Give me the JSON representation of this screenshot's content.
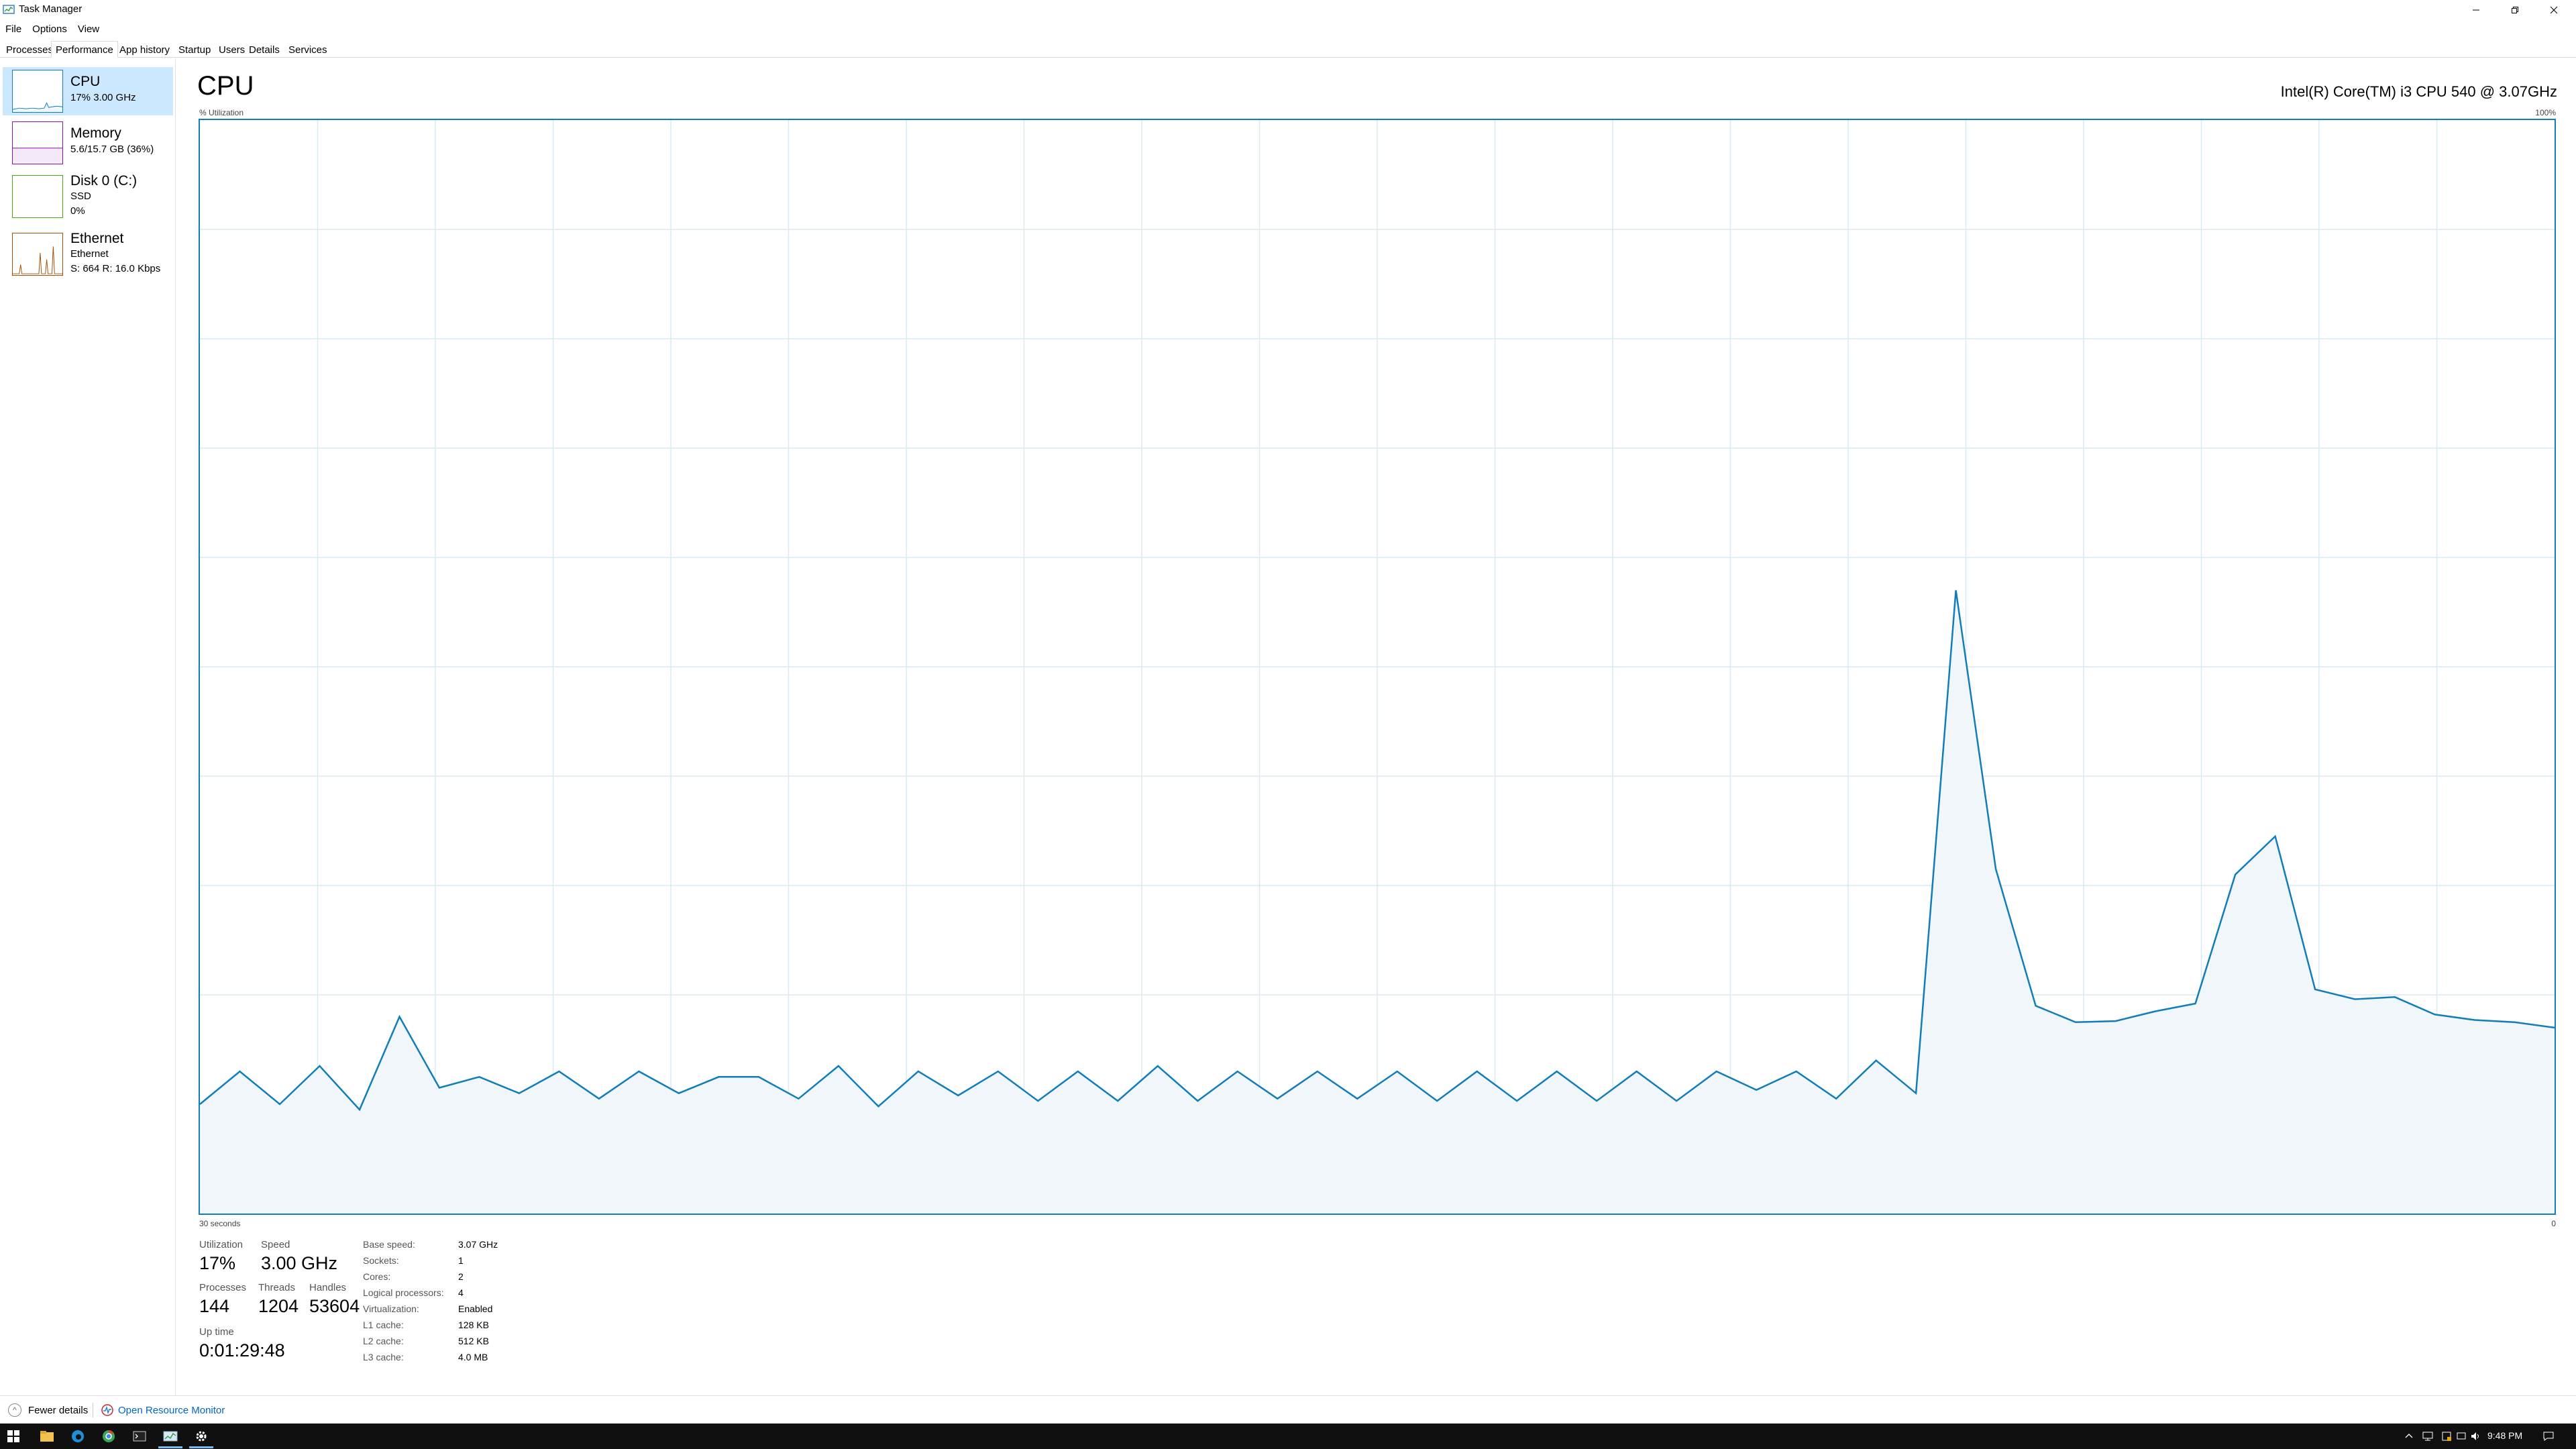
{
  "window": {
    "title": "Task Manager"
  },
  "menu": [
    "File",
    "Options",
    "View"
  ],
  "tabs": [
    "Processes",
    "Performance",
    "App history",
    "Startup",
    "Users",
    "Details",
    "Services"
  ],
  "active_tab": "Performance",
  "sidebar": {
    "items": [
      {
        "title": "CPU",
        "lines": [
          "17% 3.00 GHz"
        ],
        "color": "#117dbb"
      },
      {
        "title": "Memory",
        "lines": [
          "5.6/15.7 GB (36%)"
        ],
        "color": "#8b12ae"
      },
      {
        "title": "Disk 0 (C:)",
        "lines": [
          "SSD",
          "0%"
        ],
        "color": "#4da60c"
      },
      {
        "title": "Ethernet",
        "lines": [
          "Ethernet",
          "S: 664  R: 16.0 Kbps"
        ],
        "color": "#a74f01"
      }
    ]
  },
  "main": {
    "heading": "CPU",
    "cpu_model": "Intel(R) Core(TM) i3 CPU 540 @ 3.07GHz",
    "graph_label": "% Utilization",
    "graph_max": "100%",
    "time_span": "30 seconds",
    "graph_min": "0",
    "utilization_history": [
      10,
      13,
      10,
      13.5,
      9.5,
      18,
      11.5,
      12.5,
      11,
      13,
      10.5,
      13,
      11,
      12.5,
      12.5,
      10.5,
      13.5,
      9.8,
      13,
      10.8,
      13,
      10.3,
      13,
      10.3,
      13.5,
      10.3,
      13,
      10.5,
      13,
      10.5,
      13,
      10.3,
      13,
      10.3,
      13,
      10.3,
      13,
      10.3,
      13,
      11.3,
      13,
      10.5,
      14,
      11,
      57,
      31.5,
      19,
      17.5,
      17.6,
      18.5,
      19.2,
      31,
      34.5,
      20.5,
      19.6,
      19.8,
      18.2,
      17.7,
      17.5,
      17
    ]
  },
  "stats": {
    "utilization": {
      "label": "Utilization",
      "value": "17%"
    },
    "speed": {
      "label": "Speed",
      "value": "3.00 GHz"
    },
    "processes": {
      "label": "Processes",
      "value": "144"
    },
    "threads": {
      "label": "Threads",
      "value": "1204"
    },
    "handles": {
      "label": "Handles",
      "value": "53604"
    },
    "uptime": {
      "label": "Up time",
      "value": "0:01:29:48"
    }
  },
  "specs": [
    {
      "label": "Base speed:",
      "value": "3.07 GHz"
    },
    {
      "label": "Sockets:",
      "value": "1"
    },
    {
      "label": "Cores:",
      "value": "2"
    },
    {
      "label": "Logical processors:",
      "value": "4"
    },
    {
      "label": "Virtualization:",
      "value": "Enabled"
    },
    {
      "label": "L1 cache:",
      "value": "128 KB"
    },
    {
      "label": "L2 cache:",
      "value": "512 KB"
    },
    {
      "label": "L3 cache:",
      "value": "4.0 MB"
    }
  ],
  "footer": {
    "fewer_details": "Fewer details",
    "open_monitor": "Open Resource Monitor"
  },
  "taskbar": {
    "time": "9:48 PM"
  },
  "colors": {
    "accent": "#117dbb",
    "selected_bg": "#cce8ff",
    "graph_fill": "#f1f6fa",
    "grid": "#d9eaf4"
  }
}
